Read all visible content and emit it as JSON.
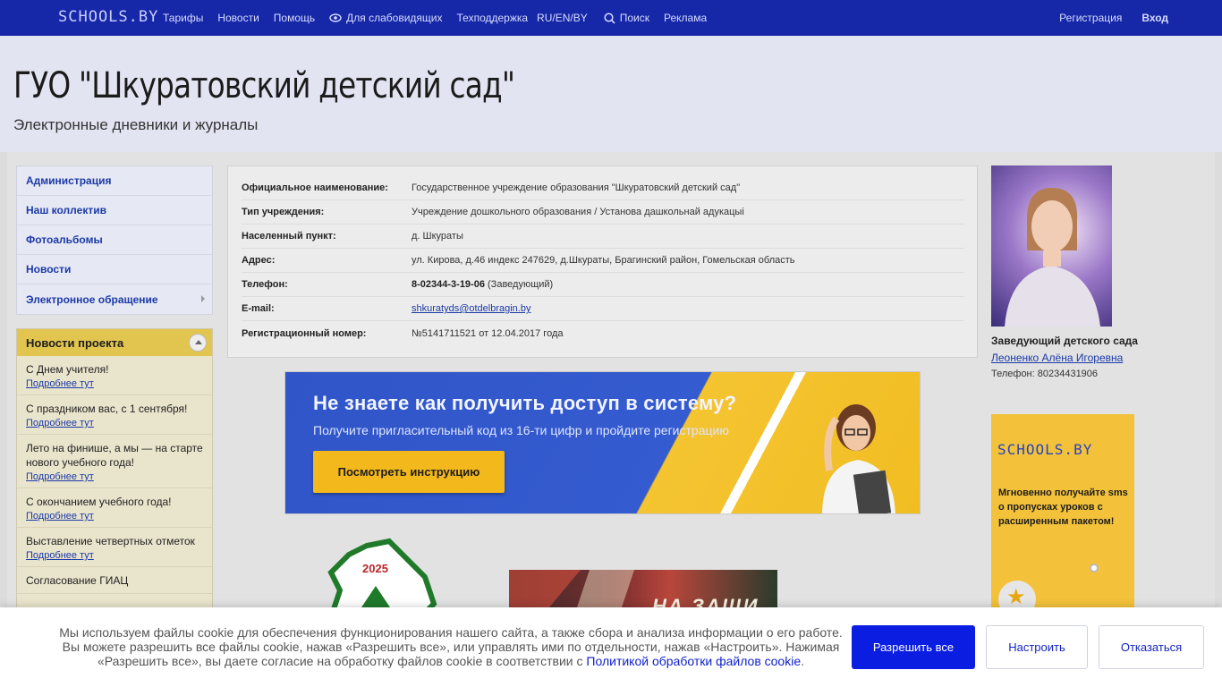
{
  "topbar": {
    "logo": "SCHOOLS.BY",
    "nav": [
      "Тарифы",
      "Новости",
      "Помощь"
    ],
    "accessibility": "Для слабовидящих",
    "support": "Техподдержка",
    "lang": "RU/EN/BY",
    "search": "Поиск",
    "ads": "Реклама",
    "register": "Регистрация",
    "login": "Вход"
  },
  "header": {
    "title": "ГУО \"Шкуратовский детский сад\"",
    "subtitle": "Электронные дневники и журналы"
  },
  "sidebar": {
    "items": [
      "Администрация",
      "Наш коллектив",
      "Фотоальбомы",
      "Новости",
      "Электронное обращение"
    ]
  },
  "news": {
    "title": "Новости проекта",
    "more": "Подробнее тут",
    "items": [
      "С Днем учителя!",
      "С праздником вас, с 1 сентября!",
      "Лето на финише, а мы — на старте нового учебного года!",
      "С окончанием учебного года!",
      "Выставление четвертных отметок",
      "Согласование ГИАЦ"
    ]
  },
  "info": {
    "rows": [
      {
        "k": "Официальное наименование:",
        "v": "Государственное учреждение образования \"Шкуратовский детский сад\""
      },
      {
        "k": "Тип учреждения:",
        "v": "Учреждение дошкольного образования / Установа дашкольнай адукацыі"
      },
      {
        "k": "Населенный пункт:",
        "v": "д. Шкураты"
      },
      {
        "k": "Адрес:",
        "v": "ул. Кирова, д.46 индекс 247629, д.Шкураты, Брагинский район, Гомельская область"
      },
      {
        "k": "Телефон:",
        "phone": "8-02344-3-19-06",
        "note": "(Заведующий)"
      },
      {
        "k": "E-mail:",
        "email": "shkuratyds@otdelbragin.by"
      },
      {
        "k": "Регистрационный номер:",
        "v": "№5141711521 от 12.04.2017 года"
      }
    ]
  },
  "banner": {
    "headline": "Не знаете как получить доступ в систему?",
    "sub": "Получите пригласительный код из 16-ти цифр и пройдите регистрацию",
    "button": "Посмотреть инструкцию"
  },
  "director": {
    "role": "Заведующий детского сада",
    "name": "Леоненко Алёна Игоревна",
    "phone": "Телефон: 80234431906"
  },
  "ad": {
    "logo": "SCHOOLS.BY",
    "text": "Мгновенно получайте sms о пропусках уроков с расширенным пакетом!"
  },
  "emblem": {
    "year": "2025"
  },
  "poster": {
    "text": "НА ЗАЩИ"
  },
  "cookie": {
    "text": "Мы используем файлы cookie для обеспечения функционирования нашего сайта, а также сбора и анализа информации о его работе. Вы можете разрешить все файлы cookie, нажав «Разрешить все», или управлять ими по отдельности, нажав «Настроить». Нажимая «Разрешить все», вы даете согласие на обработку файлов cookie в соответствии с",
    "link": "Политикой обработки файлов cookie",
    "allow": "Разрешить все",
    "settings": "Настроить",
    "decline": "Отказаться"
  },
  "colors": {
    "topbar": "#1627a8",
    "link": "#1b3aa8",
    "accent": "#0a1de0",
    "news_head": "#e2c54f"
  }
}
